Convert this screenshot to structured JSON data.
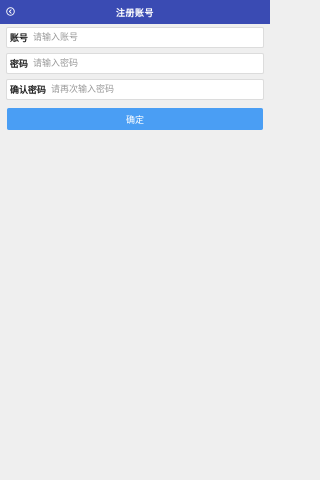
{
  "header": {
    "title": "注册账号",
    "back_icon": "back-circle-icon",
    "bg_color": "#3a4bb3"
  },
  "form": {
    "account": {
      "label": "账号",
      "placeholder": "请输入账号"
    },
    "password": {
      "label": "密码",
      "placeholder": "请输入密码"
    },
    "confirm_password": {
      "label": "确认密码",
      "placeholder": "请再次输入密码"
    }
  },
  "confirm_button": {
    "label": "确定",
    "color": "#4a9ef4"
  }
}
